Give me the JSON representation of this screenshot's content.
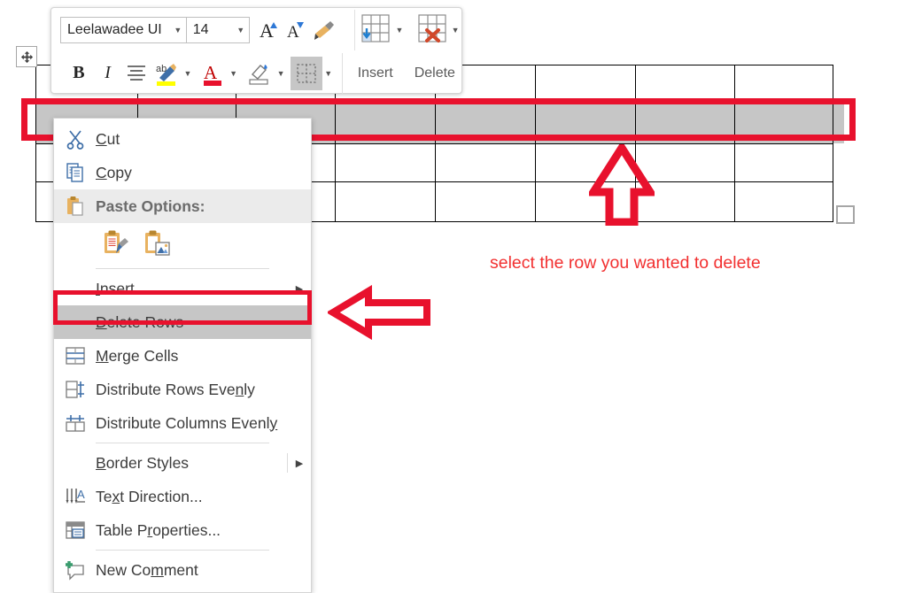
{
  "app": "Microsoft Word table context menu",
  "mini_toolbar": {
    "font_name": "Leelawadee UI",
    "font_size": "14",
    "buttons": [
      {
        "name": "grow-font-icon",
        "label": "A"
      },
      {
        "name": "shrink-font-icon",
        "label": "A"
      },
      {
        "name": "format-painter-icon",
        "label": ""
      },
      {
        "name": "insert-table-icon",
        "label": ""
      },
      {
        "name": "delete-table-icon",
        "label": ""
      },
      {
        "name": "bold-icon",
        "label": "B"
      },
      {
        "name": "italic-icon",
        "label": "I"
      },
      {
        "name": "align-icon",
        "label": ""
      },
      {
        "name": "text-highlight-color-icon",
        "label": "ab"
      },
      {
        "name": "font-color-icon",
        "label": "A"
      },
      {
        "name": "shading-icon",
        "label": ""
      },
      {
        "name": "borders-icon",
        "label": ""
      }
    ],
    "insert_label": "Insert",
    "delete_label": "Delete"
  },
  "context_menu": {
    "items": [
      {
        "icon": "cut-icon",
        "label": "Cut",
        "accel": "t",
        "submenu": false
      },
      {
        "icon": "copy-icon",
        "label": "Copy",
        "accel": "C",
        "submenu": false
      },
      {
        "icon": "paste-icon",
        "label": "Paste Options:",
        "accel": "",
        "submenu": false
      },
      {
        "icon": "",
        "label": "Insert",
        "accel": "I",
        "submenu": true
      },
      {
        "icon": "",
        "label": "Delete Rows",
        "accel": "D",
        "submenu": false
      },
      {
        "icon": "merge-cells-icon",
        "label": "Merge Cells",
        "accel": "M",
        "submenu": false
      },
      {
        "icon": "distribute-rows-icon",
        "label": "Distribute Rows Evenly",
        "accel": "n",
        "submenu": false
      },
      {
        "icon": "distribute-columns-icon",
        "label": "Distribute Columns Evenly",
        "accel": "y",
        "submenu": false
      },
      {
        "icon": "",
        "label": "Border Styles",
        "accel": "B",
        "submenu": true
      },
      {
        "icon": "text-direction-icon",
        "label": "Text Direction...",
        "accel": "x",
        "submenu": false
      },
      {
        "icon": "table-properties-icon",
        "label": "Table Properties...",
        "accel": "r",
        "submenu": false
      },
      {
        "icon": "new-comment-icon",
        "label": "New Comment",
        "accel": "m",
        "submenu": false
      }
    ],
    "paste_option_icons": [
      {
        "name": "paste-keep-source-formatting-icon"
      },
      {
        "name": "paste-picture-icon"
      }
    ]
  },
  "annotation": {
    "text": "select the row you wanted to delete",
    "color": "#f23030",
    "arrow_up_name": "up-arrow-callout",
    "arrow_left_name": "left-arrow-callout"
  },
  "document_table": {
    "columns": 8,
    "rows": 4,
    "selected_row_index": 1,
    "selection_color": "#c6c6c6",
    "border_color": "#000000",
    "move_handle": "table-move-handle",
    "resize_handle": "table-resize-handle"
  }
}
